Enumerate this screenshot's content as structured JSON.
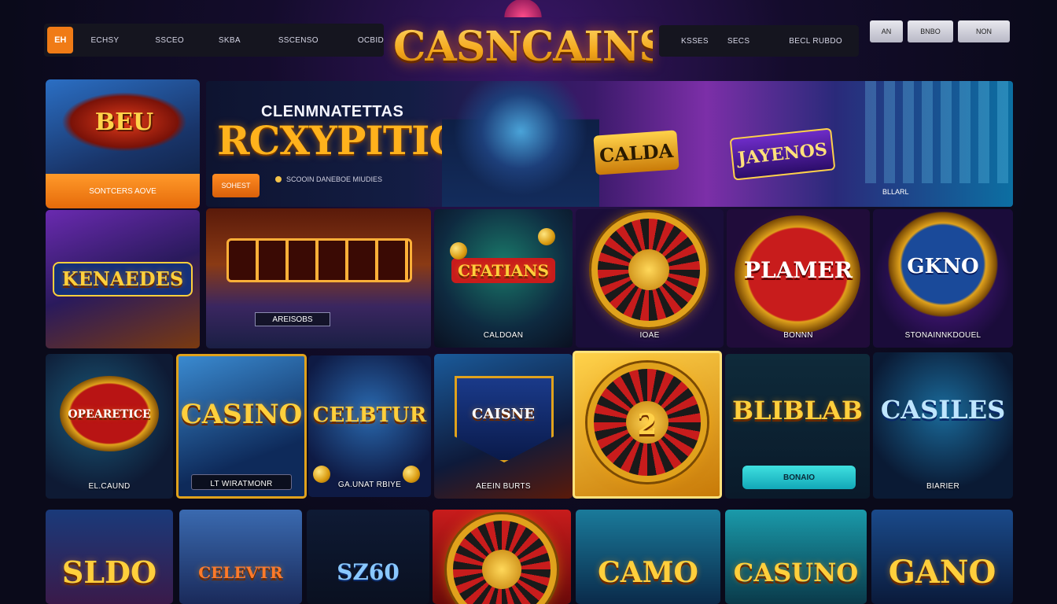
{
  "header": {
    "home_label": "EH",
    "nav_left": [
      "ECHSY",
      "SSCEO",
      "SKBA",
      "SSCENSO",
      "OCBID"
    ],
    "logo_text": "CASNCAINS",
    "nav_right": [
      "KSSES",
      "SECS",
      "BECL RUBDO"
    ],
    "auth": [
      "AN",
      "BNBO",
      "NON"
    ]
  },
  "promo": {
    "sign_text": "BEU",
    "button_label": "SONTCERS AOVE"
  },
  "hero": {
    "subtitle": "CLENMNATETTAS",
    "title": "RCXYPITIO",
    "button_label": "SOHEST",
    "note": "SCOOIN DANEBOE MIUDIES",
    "sign_left": "CALDA",
    "sign_right": "JAYENOS",
    "corner_label": "BLLARL"
  },
  "row1": [
    {
      "art": "KENAEDES",
      "label": ""
    },
    {
      "art": "",
      "label": "AREISOBS"
    },
    {
      "art": "CFATIANS",
      "label": "CALDOAN"
    },
    {
      "art": "",
      "label": "IOAE"
    },
    {
      "art": "PLAMER",
      "label": "BONNN"
    },
    {
      "art": "GKNO",
      "label": "STONAINNKDOUEL"
    }
  ],
  "row2": [
    {
      "art": "OPEARETICE",
      "label": "EL.CAUND"
    },
    {
      "art": "CASINO",
      "label": "LT WIRATMONR"
    },
    {
      "art": "CELBTUR",
      "label": "GA.UNAT RBIYE"
    },
    {
      "art": "CAISNE",
      "label": "AEEIN BURTS"
    },
    {
      "art": "2",
      "label": ""
    },
    {
      "art": "BLIBLAB",
      "label": "",
      "button": "BONAIO"
    },
    {
      "art": "CASILES",
      "label": "BIARIER"
    }
  ],
  "row3": [
    {
      "art": "SLDO"
    },
    {
      "art": "CELEVTR"
    },
    {
      "art": "SZ60"
    },
    {
      "art": ""
    },
    {
      "art": "CAMO"
    },
    {
      "art": "CASUNO"
    },
    {
      "art": "GANO"
    }
  ],
  "colors": {
    "accent_orange": "#f07b16",
    "gold": "#ffcf3c",
    "teal_button": "#3fe0e0",
    "background": "#0a0a1a"
  }
}
